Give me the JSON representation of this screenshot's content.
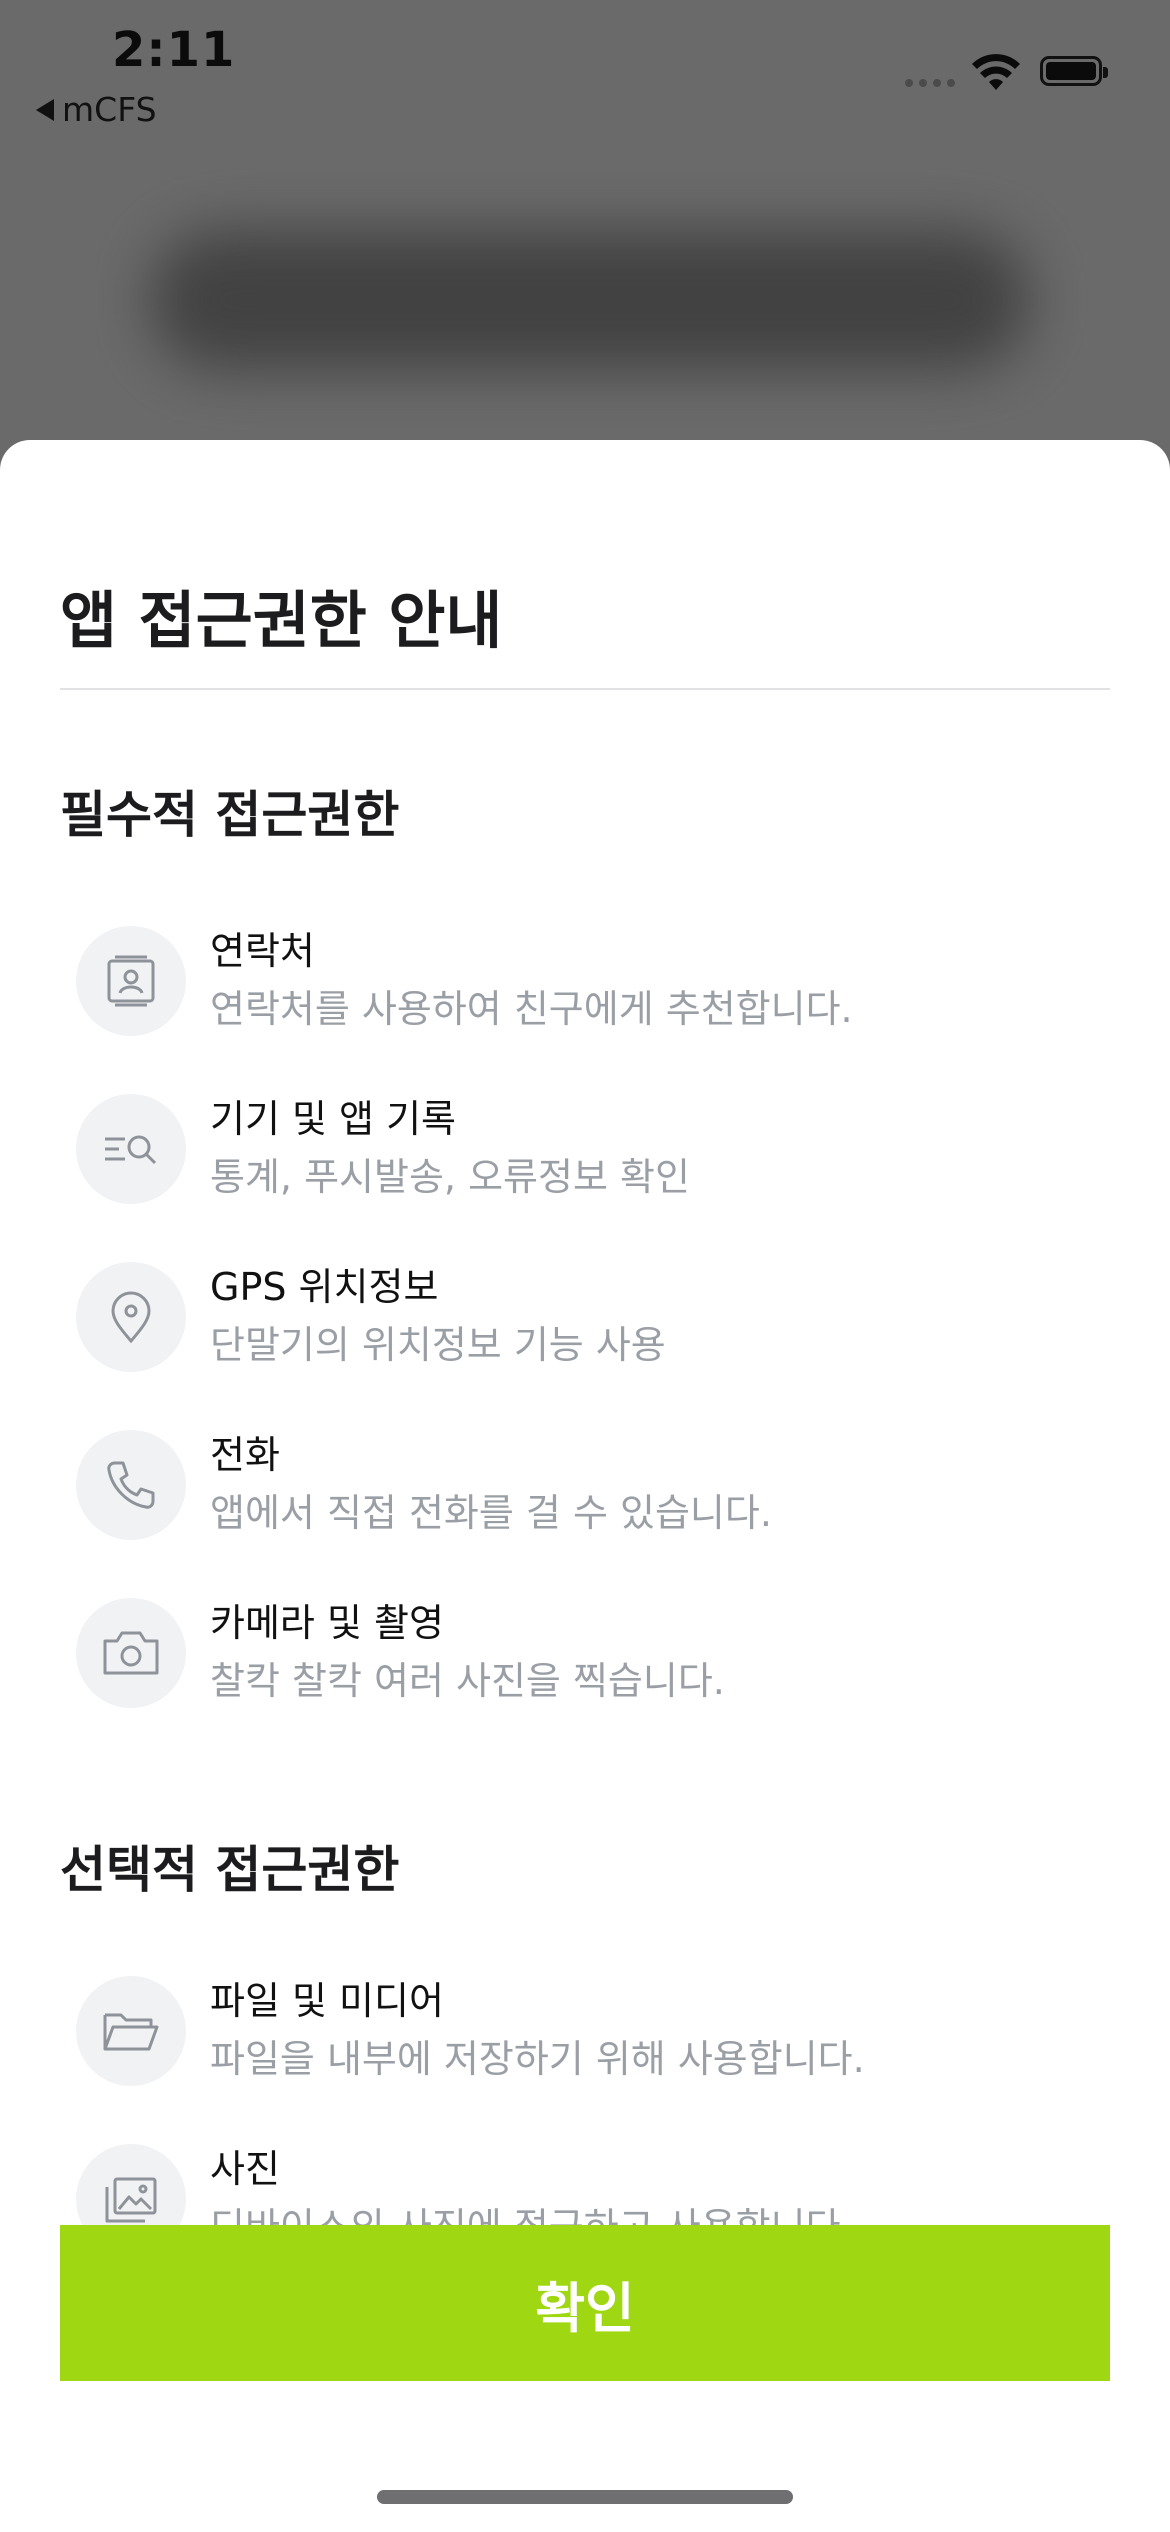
{
  "status_bar": {
    "time": "2:11",
    "back_app": "mCFS"
  },
  "sheet": {
    "title": "앱 접근권한 안내",
    "required_section": {
      "title": "필수적 접근권한",
      "items": [
        {
          "icon": "contact-card-icon",
          "label": "연락처",
          "desc": "연락처를 사용하여 친구에게 추천합니다."
        },
        {
          "icon": "search-list-icon",
          "label": "기기 및 앱 기록",
          "desc": "통계, 푸시발송, 오류정보 확인"
        },
        {
          "icon": "location-pin-icon",
          "label": "GPS 위치정보",
          "desc": "단말기의 위치정보 기능 사용"
        },
        {
          "icon": "phone-icon",
          "label": "전화",
          "desc": "앱에서 직접 전화를 걸 수 있습니다."
        },
        {
          "icon": "camera-icon",
          "label": "카메라 및 촬영",
          "desc": "찰칵 찰칵 여러 사진을 찍습니다."
        }
      ]
    },
    "optional_section": {
      "title": "선택적 접근권한",
      "items": [
        {
          "icon": "folder-icon",
          "label": "파일 및 미디어",
          "desc": "파일을 내부에 저장하기 위해 사용합니다."
        },
        {
          "icon": "photo-icon",
          "label": "사진",
          "desc": "디바이스의 사진에 접근하고 사용합니다."
        }
      ]
    },
    "confirm_label": "확인"
  },
  "colors": {
    "accent": "#9fd713",
    "desc_text": "#9a9fa6",
    "icon_bg": "#f1f2f4"
  }
}
